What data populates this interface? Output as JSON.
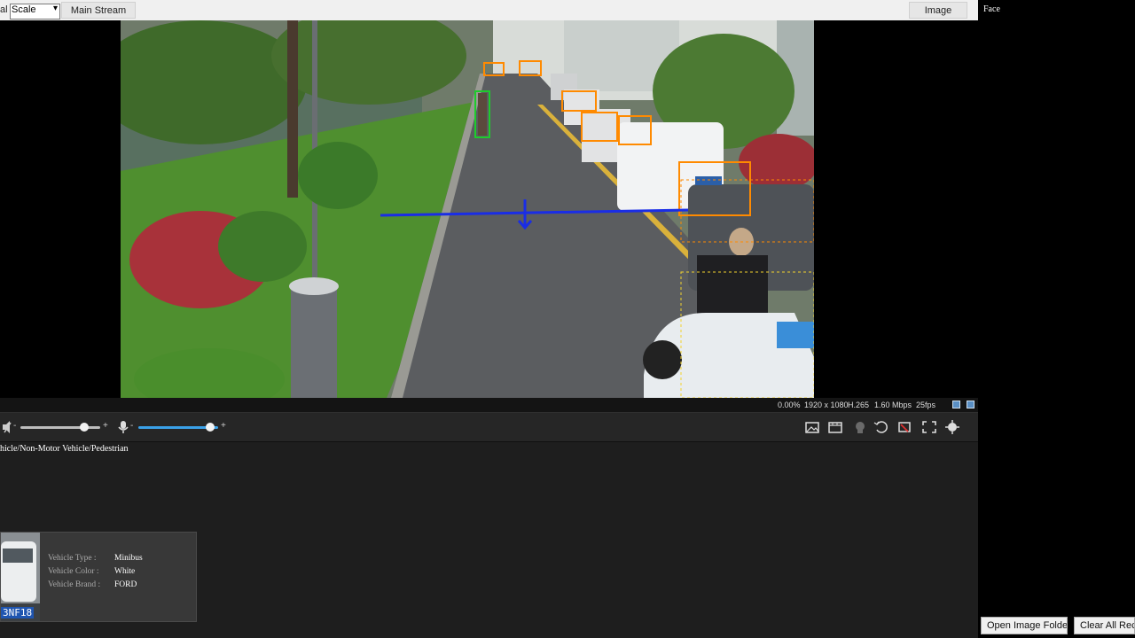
{
  "toolbar": {
    "cut_label": "al",
    "scale_select": "Scale",
    "main_stream": "Main Stream",
    "image_button": "Image"
  },
  "right_panel": {
    "title": "Face",
    "open_folder": "Open Image Folder",
    "clear_all": "Clear All Reco"
  },
  "status": {
    "loss": "0.00%",
    "resolution": "1920 x 1080",
    "codec": "H.265",
    "bitrate": "1.60 Mbps",
    "fps": "25fps"
  },
  "audio": {
    "speaker_volume": 0.8,
    "mic_volume": 0.9,
    "minus": "-",
    "plus": "+"
  },
  "results": {
    "category": "hicle/Non-Motor Vehicle/Pedestrian",
    "plate_text": "3NF18",
    "attributes": [
      {
        "key": "Vehicle Type :",
        "value": "Minibus"
      },
      {
        "key": "Vehicle Color :",
        "value": "White"
      },
      {
        "key": "Vehicle Brand :",
        "value": "FORD"
      }
    ]
  },
  "icons": {
    "bar_icons": [
      "snapshot-icon",
      "record-icon",
      "talk-icon",
      "zoom-icon",
      "ptz-icon",
      "fullscreen-icon",
      "focus-icon"
    ]
  }
}
